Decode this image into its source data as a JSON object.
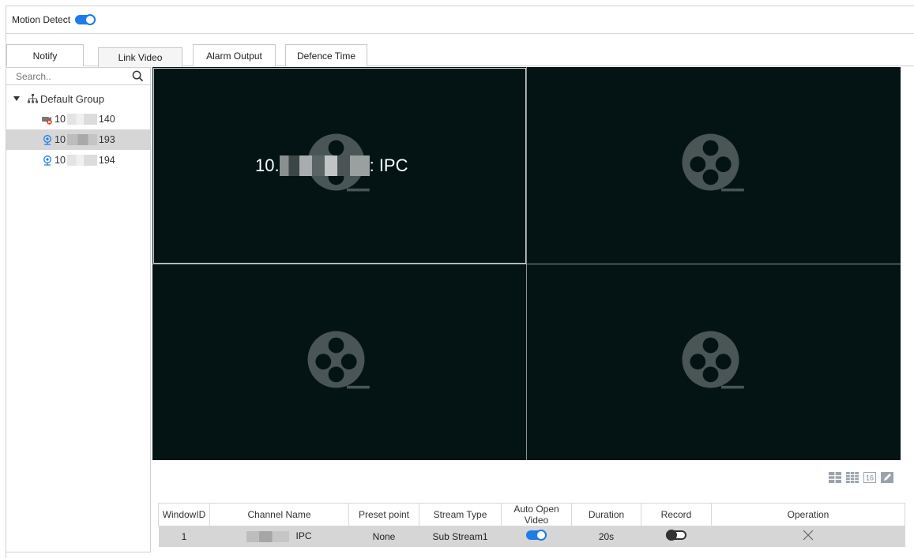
{
  "motion_detect": {
    "label": "Motion Detect",
    "enabled": true
  },
  "tabs": [
    {
      "label": "Notify",
      "active": false
    },
    {
      "label": "Link Video",
      "active": true
    },
    {
      "label": "Alarm Output",
      "active": false
    },
    {
      "label": "Defence Time",
      "active": false
    }
  ],
  "sidebar": {
    "search": {
      "placeholder": "Search.."
    },
    "group": {
      "label": "Default Group",
      "icon": "org-tree-icon"
    },
    "devices": [
      {
        "prefix": "10",
        "suffix": "140",
        "icon": "camera-offline-icon",
        "selected": false
      },
      {
        "prefix": "10",
        "suffix": "193",
        "icon": "camera-icon",
        "selected": true
      },
      {
        "prefix": "10",
        "suffix": "194",
        "icon": "camera-icon",
        "selected": false
      }
    ]
  },
  "video": {
    "window1_label_prefix": "10.",
    "window1_label_suffix": ": IPC",
    "placeholder_icon": "film-reel-icon"
  },
  "layout_buttons": [
    {
      "icon": "layout-4-icon"
    },
    {
      "icon": "layout-9-icon"
    },
    {
      "icon": "layout-16-icon",
      "text": "16"
    },
    {
      "icon": "custom-layout-icon"
    }
  ],
  "table": {
    "headers": [
      "WindowID",
      "Channel Name",
      "Preset point",
      "Stream Type",
      "Auto Open Video",
      "Duration",
      "Record",
      "Operation"
    ],
    "rows": [
      {
        "window_id": "1",
        "channel_name": "IPC",
        "preset": "None",
        "stream_type": "Sub Stream1",
        "auto_open_video": true,
        "duration": "20s",
        "record": false,
        "operation_icon": "delete-x-icon"
      }
    ]
  },
  "colors": {
    "accent": "#1e7ce8",
    "video_bg": "#041414",
    "selected_row": "#d6d6d6"
  }
}
